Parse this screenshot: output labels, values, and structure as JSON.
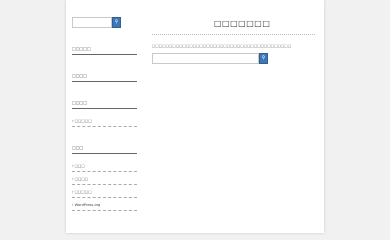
{
  "sidebar": {
    "search": {
      "placeholder": "",
      "button_icon": "search-icon"
    },
    "widgets": [
      {
        "title": "□□□□□"
      },
      {
        "title": "□□□□"
      },
      {
        "title": "□□□□",
        "links": [
          "□□□□□"
        ]
      },
      {
        "title": "□□□",
        "links": [
          "□□□",
          "□□□□",
          "□□□□□",
          "WordPress.org"
        ]
      }
    ]
  },
  "main": {
    "title": "□□□□□□□",
    "description": "□□□□□□□□□□□□□□□□□□□□□□□□□□□□□□□□□□□□□□□□□",
    "search": {
      "placeholder": "",
      "button_icon": "search-icon"
    }
  },
  "colors": {
    "accent": "#3d77b5",
    "page_bg": "#ffffff",
    "body_bg": "#f1f1f1"
  }
}
